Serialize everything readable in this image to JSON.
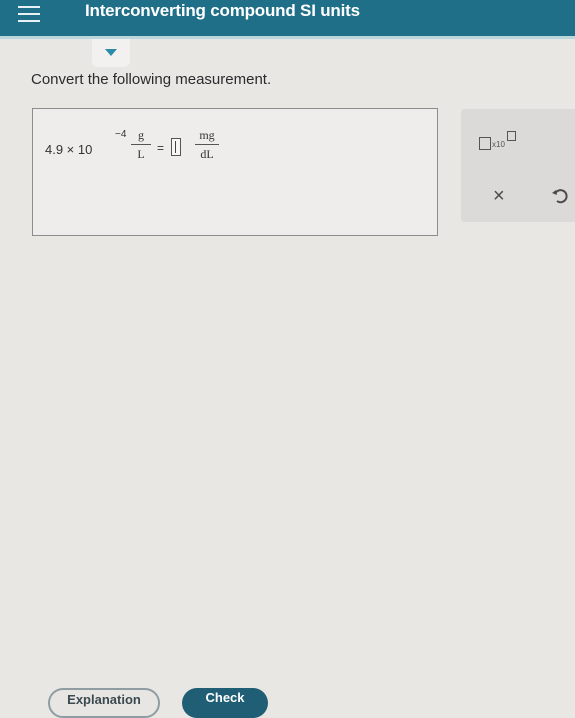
{
  "header": {
    "title": "Interconverting compound SI units",
    "menu_icon": "hamburger-icon"
  },
  "collapse_icon": "triangle-down-icon",
  "question": {
    "prompt": "Convert the following measurement."
  },
  "expression": {
    "mantissa": "4.9 × 10",
    "exponent": "−4",
    "from_units": {
      "numerator": "g",
      "denominator": "L"
    },
    "equals": "=",
    "answer_value": "",
    "to_units": {
      "numerator": "mg",
      "denominator": "dL"
    }
  },
  "tools": {
    "sci_notation_label": "x10",
    "clear_icon": "x-icon",
    "clear_label": "×",
    "undo_icon": "undo-icon"
  },
  "footer": {
    "explanation_label": "Explanation",
    "check_label": "Check"
  },
  "colors": {
    "header_bg": "#1f6f88",
    "accent": "#2a8aa8",
    "check_bg": "#1f5e74"
  }
}
